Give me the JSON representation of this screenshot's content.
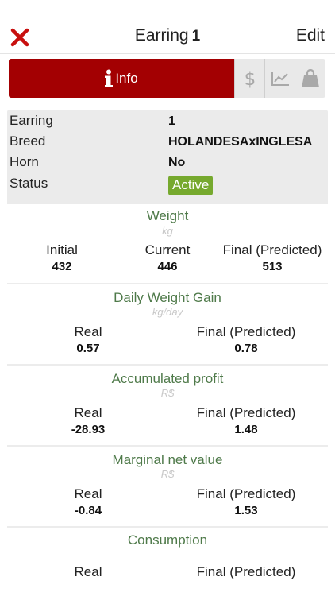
{
  "header": {
    "title_label": "Earring",
    "title_number": "1",
    "edit_label": "Edit"
  },
  "tabs": {
    "info_label": "Info",
    "icons": [
      "info-icon",
      "dollar-icon",
      "chart-icon",
      "bag-icon"
    ]
  },
  "colors": {
    "primary": "#a30002",
    "status_active": "#76a92e",
    "section_title": "#4f7a4a"
  },
  "info": {
    "earring_label": "Earring",
    "earring_value": "1",
    "breed_label": "Breed",
    "breed_value": "HOLANDESAxINGLESA",
    "horn_label": "Horn",
    "horn_value": "No",
    "status_label": "Status",
    "status_value": "Active"
  },
  "weight": {
    "title": "Weight",
    "unit": "kg",
    "initial_label": "Initial",
    "initial_value": "432",
    "current_label": "Current",
    "current_value": "446",
    "final_label": "Final (Predicted)",
    "final_value": "513"
  },
  "daily_gain": {
    "title": "Daily Weight Gain",
    "unit": "kg/day",
    "real_label": "Real",
    "real_value": "0.57",
    "final_label": "Final (Predicted)",
    "final_value": "0.78"
  },
  "profit": {
    "title": "Accumulated profit",
    "unit": "R$",
    "real_label": "Real",
    "real_value": "-28.93",
    "final_label": "Final (Predicted)",
    "final_value": "1.48"
  },
  "marginal": {
    "title": "Marginal net value",
    "unit": "R$",
    "real_label": "Real",
    "real_value": "-0.84",
    "final_label": "Final (Predicted)",
    "final_value": "1.53"
  },
  "consumption": {
    "title": "Consumption",
    "real_label": "Real",
    "final_label": "Final (Predicted)"
  }
}
